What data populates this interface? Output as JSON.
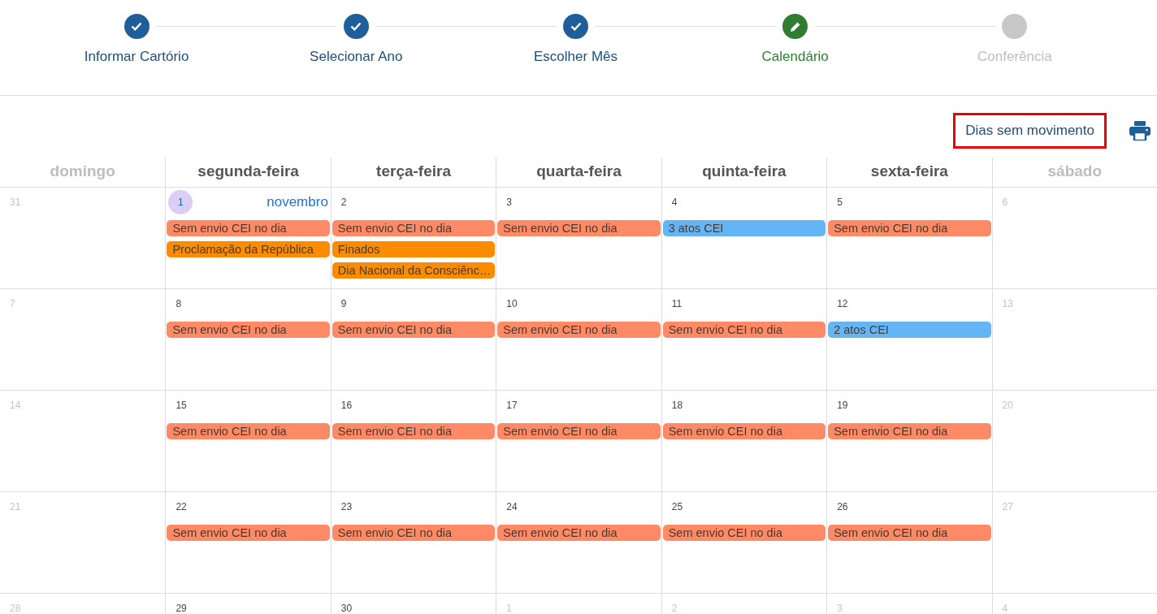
{
  "steps": [
    {
      "label": "Informar Cartório",
      "completed": true,
      "current": false
    },
    {
      "label": "Selecionar Ano",
      "completed": true,
      "current": false
    },
    {
      "label": "Escolher Mês",
      "completed": true,
      "current": false
    },
    {
      "label": "Calendário",
      "completed": false,
      "current": true
    },
    {
      "label": "Conferência",
      "completed": false,
      "current": false
    }
  ],
  "toolbar": {
    "no_movement_button": "Dias sem movimento"
  },
  "weekdays": [
    {
      "label": "domingo",
      "weekend": true
    },
    {
      "label": "segunda-feira",
      "weekend": false
    },
    {
      "label": "terça-feira",
      "weekend": false
    },
    {
      "label": "quarta-feira",
      "weekend": false
    },
    {
      "label": "quinta-feira",
      "weekend": false
    },
    {
      "label": "sexta-feira",
      "weekend": false
    },
    {
      "label": "sábado",
      "weekend": true
    }
  ],
  "weeks": [
    [
      {
        "day": "31",
        "other_month": true
      },
      {
        "day": "1",
        "other_month": false,
        "highlighted": true,
        "month_label": "novembro",
        "events": [
          {
            "text": "Sem envio CEI no dia",
            "color": "#ff8a65"
          },
          {
            "text": "Proclamação da República",
            "color": "#fb8c00"
          }
        ]
      },
      {
        "day": "2",
        "other_month": false,
        "events": [
          {
            "text": "Sem envio CEI no dia",
            "color": "#ff8a65"
          },
          {
            "text": "Finados",
            "color": "#fb8c00"
          },
          {
            "text": "Dia Nacional da Consciênc…",
            "color": "#fb8c00"
          }
        ]
      },
      {
        "day": "3",
        "other_month": false,
        "events": [
          {
            "text": "Sem envio CEI no dia",
            "color": "#ff8a65"
          }
        ]
      },
      {
        "day": "4",
        "other_month": false,
        "events": [
          {
            "text": "3 atos CEI",
            "color": "#64b5f6"
          }
        ]
      },
      {
        "day": "5",
        "other_month": false,
        "events": [
          {
            "text": "Sem envio CEI no dia",
            "color": "#ff8a65"
          }
        ]
      },
      {
        "day": "6",
        "other_month": true
      }
    ],
    [
      {
        "day": "7",
        "other_month": true
      },
      {
        "day": "8",
        "other_month": false,
        "events": [
          {
            "text": "Sem envio CEI no dia",
            "color": "#ff8a65"
          }
        ]
      },
      {
        "day": "9",
        "other_month": false,
        "events": [
          {
            "text": "Sem envio CEI no dia",
            "color": "#ff8a65"
          }
        ]
      },
      {
        "day": "10",
        "other_month": false,
        "events": [
          {
            "text": "Sem envio CEI no dia",
            "color": "#ff8a65"
          }
        ]
      },
      {
        "day": "11",
        "other_month": false,
        "events": [
          {
            "text": "Sem envio CEI no dia",
            "color": "#ff8a65"
          }
        ]
      },
      {
        "day": "12",
        "other_month": false,
        "events": [
          {
            "text": "2 atos CEI",
            "color": "#64b5f6"
          }
        ]
      },
      {
        "day": "13",
        "other_month": true
      }
    ],
    [
      {
        "day": "14",
        "other_month": true
      },
      {
        "day": "15",
        "other_month": false,
        "events": [
          {
            "text": "Sem envio CEI no dia",
            "color": "#ff8a65"
          }
        ]
      },
      {
        "day": "16",
        "other_month": false,
        "events": [
          {
            "text": "Sem envio CEI no dia",
            "color": "#ff8a65"
          }
        ]
      },
      {
        "day": "17",
        "other_month": false,
        "events": [
          {
            "text": "Sem envio CEI no dia",
            "color": "#ff8a65"
          }
        ]
      },
      {
        "day": "18",
        "other_month": false,
        "events": [
          {
            "text": "Sem envio CEI no dia",
            "color": "#ff8a65"
          }
        ]
      },
      {
        "day": "19",
        "other_month": false,
        "events": [
          {
            "text": "Sem envio CEI no dia",
            "color": "#ff8a65"
          }
        ]
      },
      {
        "day": "20",
        "other_month": true
      }
    ],
    [
      {
        "day": "21",
        "other_month": true
      },
      {
        "day": "22",
        "other_month": false,
        "events": [
          {
            "text": "Sem envio CEI no dia",
            "color": "#ff8a65"
          }
        ]
      },
      {
        "day": "23",
        "other_month": false,
        "events": [
          {
            "text": "Sem envio CEI no dia",
            "color": "#ff8a65"
          }
        ]
      },
      {
        "day": "24",
        "other_month": false,
        "events": [
          {
            "text": "Sem envio CEI no dia",
            "color": "#ff8a65"
          }
        ]
      },
      {
        "day": "25",
        "other_month": false,
        "events": [
          {
            "text": "Sem envio CEI no dia",
            "color": "#ff8a65"
          }
        ]
      },
      {
        "day": "26",
        "other_month": false,
        "events": [
          {
            "text": "Sem envio CEI no dia",
            "color": "#ff8a65"
          }
        ]
      },
      {
        "day": "27",
        "other_month": true
      }
    ],
    [
      {
        "day": "28",
        "other_month": true
      },
      {
        "day": "29",
        "other_month": false
      },
      {
        "day": "30",
        "other_month": false
      },
      {
        "day": "1",
        "other_month": true
      },
      {
        "day": "2",
        "other_month": true
      },
      {
        "day": "3",
        "other_month": true
      },
      {
        "day": "4",
        "other_month": true
      }
    ]
  ]
}
